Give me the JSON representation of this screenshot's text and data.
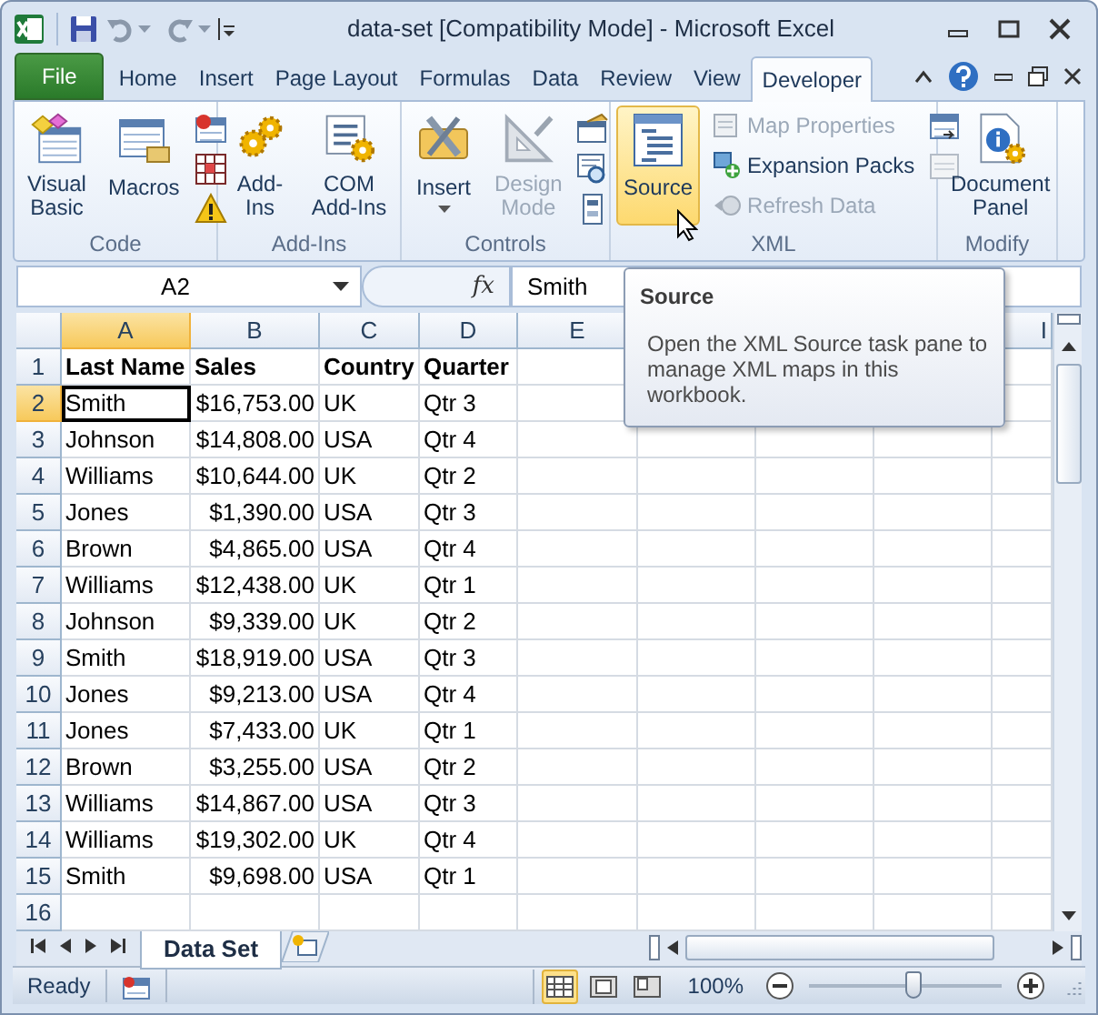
{
  "window": {
    "title": "data-set  [Compatibility Mode] - Microsoft Excel"
  },
  "tabs": [
    {
      "label": "File",
      "kind": "file",
      "selected": false
    },
    {
      "label": "Home",
      "kind": "tab",
      "selected": false
    },
    {
      "label": "Insert",
      "kind": "tab",
      "selected": false
    },
    {
      "label": "Page Layout",
      "kind": "tab",
      "selected": false
    },
    {
      "label": "Formulas",
      "kind": "tab",
      "selected": false
    },
    {
      "label": "Data",
      "kind": "tab",
      "selected": false
    },
    {
      "label": "Review",
      "kind": "tab",
      "selected": false
    },
    {
      "label": "View",
      "kind": "tab",
      "selected": false
    },
    {
      "label": "Developer",
      "kind": "tab",
      "selected": true
    }
  ],
  "ribbon": {
    "groups": [
      {
        "label": "Code",
        "buttons": [
          {
            "kind": "large",
            "label": "Visual Basic",
            "disabled": false,
            "hovered": false
          },
          {
            "kind": "large",
            "label": "Macros",
            "disabled": false,
            "hovered": false
          }
        ]
      },
      {
        "label": "Add-Ins",
        "buttons": [
          {
            "kind": "large",
            "label": "Add-Ins",
            "disabled": false,
            "hovered": false
          },
          {
            "kind": "large",
            "label": "COM Add-Ins",
            "disabled": false,
            "hovered": false
          }
        ]
      },
      {
        "label": "Controls",
        "buttons": [
          {
            "kind": "large-menu",
            "label": "Insert",
            "disabled": false,
            "hovered": false
          },
          {
            "kind": "large",
            "label": "Design Mode",
            "disabled": true,
            "hovered": false
          }
        ]
      },
      {
        "label": "XML",
        "buttons": [
          {
            "kind": "large",
            "label": "Source",
            "disabled": false,
            "hovered": true
          },
          {
            "kind": "row",
            "label": "Map Properties",
            "disabled": true,
            "hovered": false
          },
          {
            "kind": "row",
            "label": "Expansion Packs",
            "disabled": false,
            "hovered": false
          },
          {
            "kind": "row",
            "label": "Refresh Data",
            "disabled": true,
            "hovered": false
          }
        ]
      },
      {
        "label": "Modify",
        "buttons": [
          {
            "kind": "large",
            "label": "Document Panel",
            "disabled": false,
            "hovered": false
          }
        ]
      }
    ]
  },
  "formula_bar": {
    "name_box": "A2",
    "function_symbol": "fx",
    "value": "Smith"
  },
  "tooltip": {
    "title": "Source",
    "body": "Open the XML Source task pane to manage XML maps in this workbook."
  },
  "sheet": {
    "column_headers": [
      {
        "label": "A",
        "selected": true
      },
      {
        "label": "B",
        "selected": false,
        "numeric": true
      },
      {
        "label": "C",
        "selected": false
      },
      {
        "label": "D",
        "selected": false
      },
      {
        "label": "E",
        "selected": false
      }
    ],
    "last_column_header": "I",
    "rows": [
      {
        "number": "1",
        "kind": "header",
        "selected": false,
        "cells": [
          "Last Name",
          "Sales",
          "Country",
          "Quarter"
        ]
      },
      {
        "number": "2",
        "kind": "data",
        "selected": true,
        "cells": [
          "Smith",
          "$16,753.00",
          "UK",
          "Qtr 3"
        ]
      },
      {
        "number": "3",
        "kind": "data",
        "selected": false,
        "cells": [
          "Johnson",
          "$14,808.00",
          "USA",
          "Qtr 4"
        ]
      },
      {
        "number": "4",
        "kind": "data",
        "selected": false,
        "cells": [
          "Williams",
          "$10,644.00",
          "UK",
          "Qtr 2"
        ]
      },
      {
        "number": "5",
        "kind": "data",
        "selected": false,
        "cells": [
          "Jones",
          "$1,390.00",
          "USA",
          "Qtr 3"
        ]
      },
      {
        "number": "6",
        "kind": "data",
        "selected": false,
        "cells": [
          "Brown",
          "$4,865.00",
          "USA",
          "Qtr 4"
        ]
      },
      {
        "number": "7",
        "kind": "data",
        "selected": false,
        "cells": [
          "Williams",
          "$12,438.00",
          "UK",
          "Qtr 1"
        ]
      },
      {
        "number": "8",
        "kind": "data",
        "selected": false,
        "cells": [
          "Johnson",
          "$9,339.00",
          "UK",
          "Qtr 2"
        ]
      },
      {
        "number": "9",
        "kind": "data",
        "selected": false,
        "cells": [
          "Smith",
          "$18,919.00",
          "USA",
          "Qtr 3"
        ]
      },
      {
        "number": "10",
        "kind": "data",
        "selected": false,
        "cells": [
          "Jones",
          "$9,213.00",
          "USA",
          "Qtr 4"
        ]
      },
      {
        "number": "11",
        "kind": "data",
        "selected": false,
        "cells": [
          "Jones",
          "$7,433.00",
          "UK",
          "Qtr 1"
        ]
      },
      {
        "number": "12",
        "kind": "data",
        "selected": false,
        "cells": [
          "Brown",
          "$3,255.00",
          "USA",
          "Qtr 2"
        ]
      },
      {
        "number": "13",
        "kind": "data",
        "selected": false,
        "cells": [
          "Williams",
          "$14,867.00",
          "USA",
          "Qtr 3"
        ]
      },
      {
        "number": "14",
        "kind": "data",
        "selected": false,
        "cells": [
          "Williams",
          "$19,302.00",
          "UK",
          "Qtr 4"
        ]
      },
      {
        "number": "15",
        "kind": "data",
        "selected": false,
        "cells": [
          "Smith",
          "$9,698.00",
          "USA",
          "Qtr 1"
        ]
      },
      {
        "number": "16",
        "kind": "data",
        "selected": false
      }
    ]
  },
  "sheet_tabs": [
    {
      "label": "Data Set",
      "selected": true
    }
  ],
  "status_bar": {
    "text": "Ready",
    "views": [
      {
        "selected": true
      },
      {
        "selected": false
      },
      {
        "selected": false
      }
    ],
    "zoom": "100%",
    "zoom_level": {
      "level": 0.55
    }
  }
}
